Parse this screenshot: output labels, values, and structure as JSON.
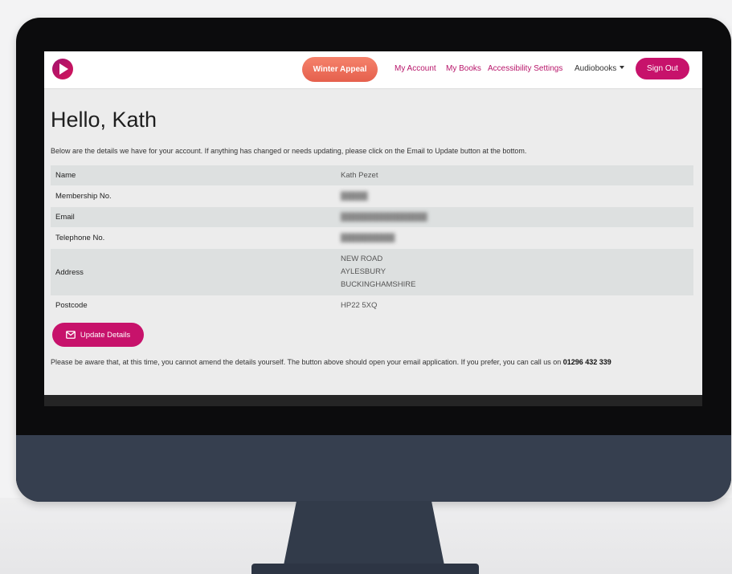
{
  "nav": {
    "winter_appeal": "Winter Appeal",
    "my_account": "My Account",
    "my_books": "My Books",
    "accessibility": "Accessibility Settings",
    "audiobooks": "Audiobooks",
    "sign_out": "Sign Out"
  },
  "greeting": "Hello, Kath",
  "intro": "Below are the details we have for your account. If anything has changed or needs updating, please click on the Email to Update button at the bottom.",
  "details": {
    "name_label": "Name",
    "name_value": "Kath Pezet",
    "membership_label": "Membership No.",
    "membership_value": "",
    "email_label": "Email",
    "email_value": "",
    "telephone_label": "Telephone No.",
    "telephone_value": "",
    "address_label": "Address",
    "address_lines": [
      "NEW ROAD",
      "AYLESBURY",
      "BUCKINGHAMSHIRE"
    ],
    "postcode_label": "Postcode",
    "postcode_value": "HP22 5XQ"
  },
  "update_button": "Update Details",
  "notice_text": "Please be aware that, at this time, you cannot amend the details yourself. The button above should open your email application. If you prefer, you can call us on",
  "notice_phone": "01296 432 339",
  "colors": {
    "brand": "#c7126b",
    "appeal": "#e86a54",
    "monitor_frame": "#0c0c0d",
    "monitor_chin": "#363f4f"
  },
  "icons": {
    "logo": "play-logo-icon",
    "dropdown": "caret-down-icon",
    "update": "envelope-icon"
  }
}
